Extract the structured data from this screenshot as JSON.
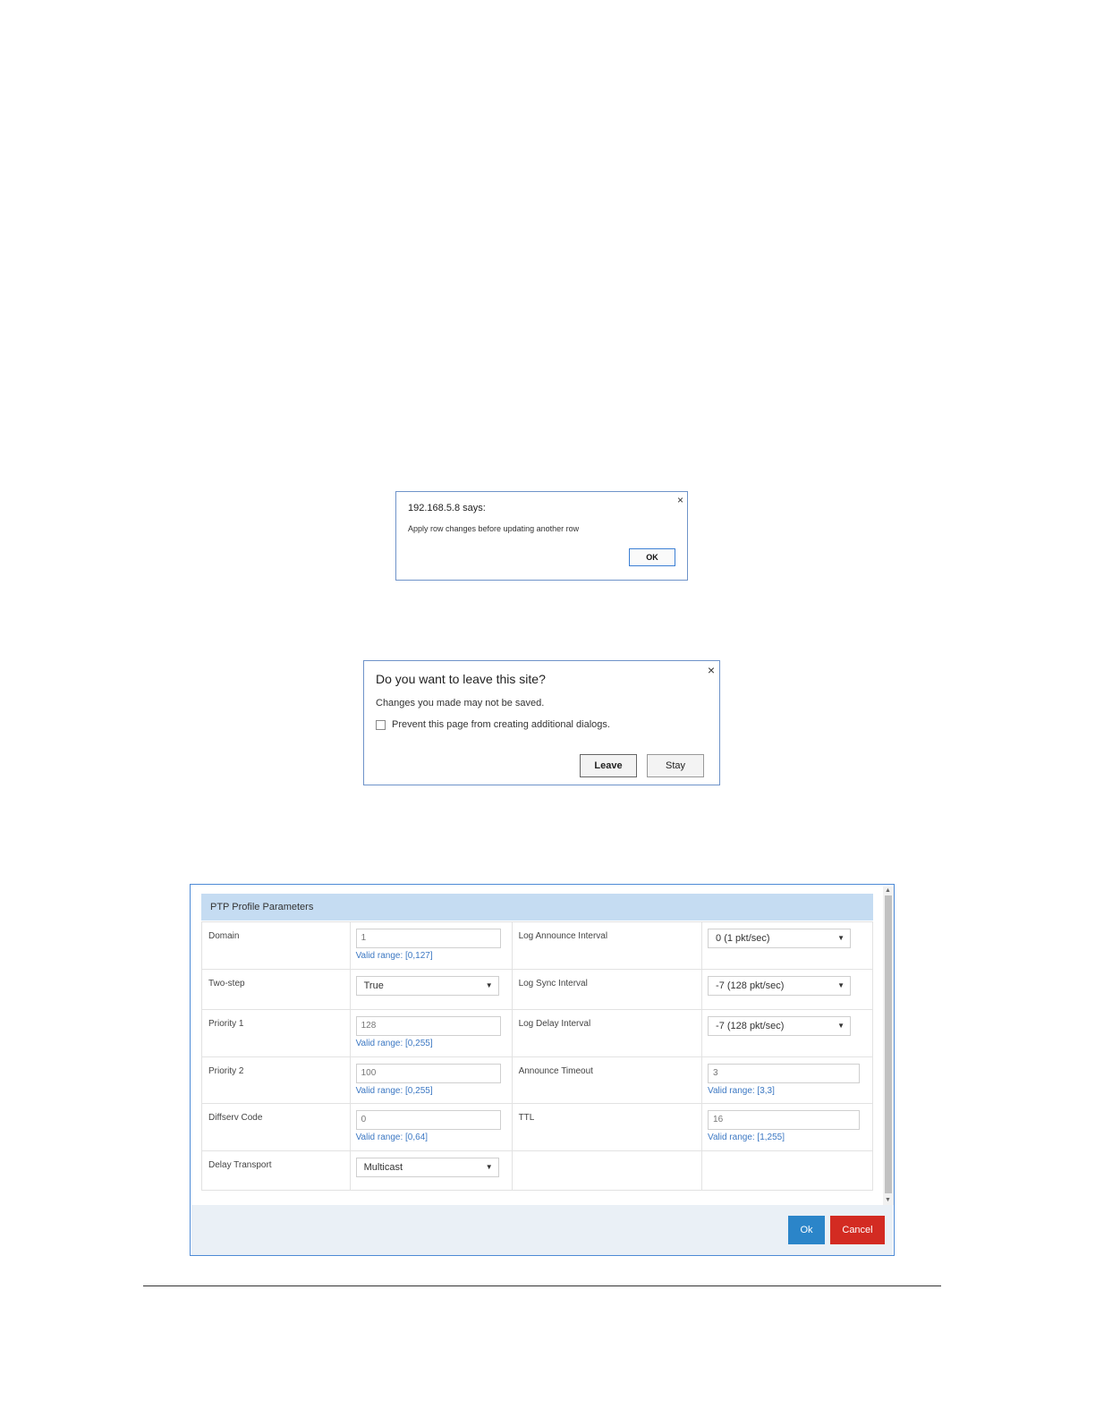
{
  "alert_row": {
    "title": "192.168.5.8 says:",
    "message": "Apply row changes before updating another row",
    "ok_label": "OK",
    "close_glyph": "×"
  },
  "alert_leave": {
    "title": "Do you want to leave this site?",
    "message": "Changes you made may not be saved.",
    "checkbox_label": "Prevent this page from creating additional dialogs.",
    "checkbox_checked": false,
    "leave_label": "Leave",
    "stay_label": "Stay",
    "close_glyph": "×"
  },
  "ptp": {
    "header": "PTP Profile Parameters",
    "rows": [
      {
        "left_label": "Domain",
        "left_value": "1",
        "left_range": "Valid range: [0,127]",
        "right_label": "Log Announce Interval",
        "right_value": "0 (1 pkt/sec)"
      },
      {
        "left_label": "Two-step",
        "left_value": "True",
        "right_label": "Log Sync Interval",
        "right_value": "-7 (128 pkt/sec)"
      },
      {
        "left_label": "Priority 1",
        "left_value": "128",
        "left_range": "Valid range: [0,255]",
        "right_label": "Log Delay Interval",
        "right_value": "-7 (128 pkt/sec)"
      },
      {
        "left_label": "Priority 2",
        "left_value": "100",
        "left_range": "Valid range: [0,255]",
        "right_label": "Announce Timeout",
        "right_value": "3",
        "right_range": "Valid range: [3,3]"
      },
      {
        "left_label": "Diffserv Code",
        "left_value": "0",
        "left_range": "Valid range: [0,64]",
        "right_label": "TTL",
        "right_value": "16",
        "right_range": "Valid range: [1,255]"
      },
      {
        "left_label": "Delay Transport",
        "left_value": "Multicast"
      }
    ],
    "ok_label": "Ok",
    "cancel_label": "Cancel",
    "dropdown_glyph": "▼",
    "scroll_up_glyph": "▲",
    "scroll_down_glyph": "▼"
  },
  "colors": {
    "ok_button": "#2b85c9",
    "cancel_button": "#d32b22",
    "header_bg": "#c5dcf2",
    "range_text": "#3c78c3"
  }
}
